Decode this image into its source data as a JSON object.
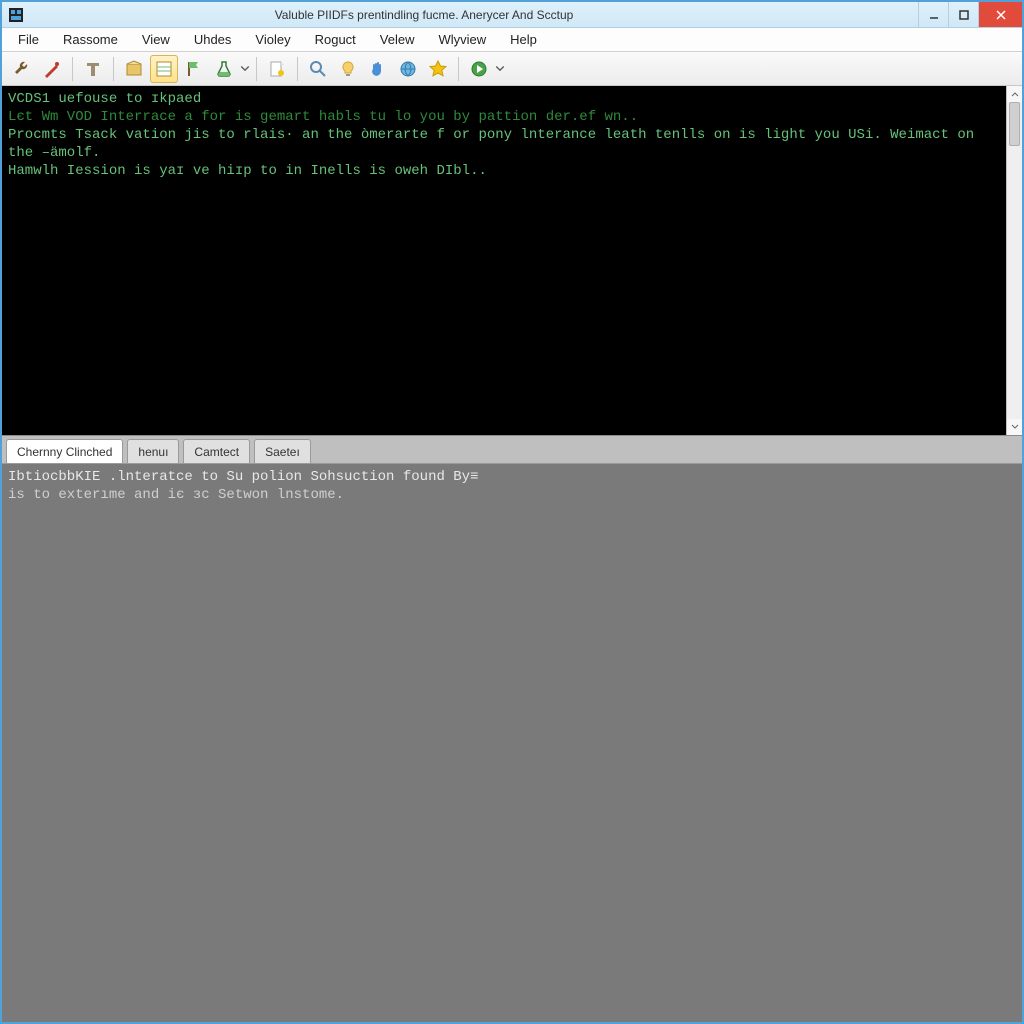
{
  "title": "Valuble PIIDFs prentindling fucme. Anerycer And Scctup",
  "menubar": {
    "items": [
      "File",
      "Rassome",
      "View",
      "Uhdes",
      "Violey",
      "Roguct",
      "Velew",
      "Wlyview",
      "Help"
    ]
  },
  "toolbar": {
    "icons": [
      "wrench-icon",
      "wand-icon",
      "text-icon",
      "box-icon",
      "sheet-icon",
      "flag-icon",
      "flask-icon",
      "page-icon",
      "search-icon",
      "bulb-icon",
      "hand-icon",
      "globe-icon",
      "star-icon",
      "globe-run-icon"
    ]
  },
  "terminal": {
    "lines": [
      {
        "class": "lt",
        "text": "VCDS1 uefouse to ɪkpaed"
      },
      {
        "class": "dk",
        "text": "Lєt Wm VOD Interrace a for is gemart habls tu lo you by pattion der.ef wn.."
      },
      {
        "class": "lt",
        "text": "Procmts Tsack vation jis to rlais· an the òmerarte f or pony lnterance leath tenlls on is light you USi. Weimact on the –ämolf."
      },
      {
        "class": "lt",
        "text": "Hamwlh Iession is yaɪ ve hiɪp to in Inells is oweh DIbl.."
      }
    ]
  },
  "tabs": {
    "items": [
      {
        "label": "Chernny Clinched",
        "active": true
      },
      {
        "label": "henuı",
        "active": false
      },
      {
        "label": "Camtect",
        "active": false
      },
      {
        "label": "Saeteı",
        "active": false
      }
    ]
  },
  "lower": {
    "lines": [
      "IbtiocbbKIE .lnteratce to Su polion Sohsuction found By≡",
      "is to exterıme and iє зc Setwon lnstome."
    ]
  },
  "colors": {
    "titlebar_bg": "#cfe8f7",
    "close_bg": "#e04b3b",
    "terminal_bg": "#000000",
    "terminal_fg_light": "#66c27a",
    "terminal_fg_dark": "#2f8a3a",
    "lower_bg": "#7a7a7a",
    "lower_fg": "#e8e8e8",
    "tab_active_bg": "#ffffff",
    "tab_bg": "#e0e0e0"
  }
}
